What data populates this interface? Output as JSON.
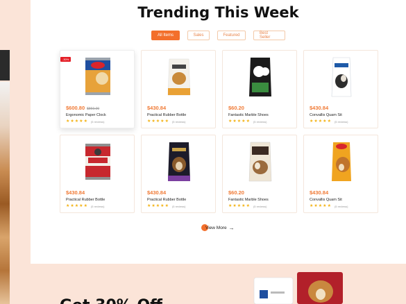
{
  "section": {
    "title": "Trending This Week"
  },
  "filters": [
    {
      "label": "All Items",
      "active": true
    },
    {
      "label": "Sales",
      "active": false
    },
    {
      "label": "Featured",
      "active": false
    },
    {
      "label": "Best Seller",
      "active": false
    }
  ],
  "products": [
    {
      "price": "$600.80",
      "old_price": "$860.00",
      "name": "Ergonomic Paper Clock",
      "stars": 5,
      "reviews": "(5 reviews)",
      "badge": "-30%",
      "image": "dog-food-can-icon"
    },
    {
      "price": "$430.84",
      "name": "Practical Rubber Bottle",
      "stars": 5,
      "reviews": "(5 reviews)",
      "image": "pet-food-bag-icon"
    },
    {
      "price": "$60.20",
      "name": "Fantastic Marble Shoes",
      "stars": 5,
      "reviews": "(5 reviews)",
      "image": "pet-food-bag-icon"
    },
    {
      "price": "$430.84",
      "name": "Convallis Quam Sit",
      "stars": 5,
      "reviews": "(5 reviews)",
      "image": "pet-food-bag-icon"
    },
    {
      "price": "$430.84",
      "name": "Practical Rubber Bottle",
      "stars": 5,
      "reviews": "(5 reviews)",
      "image": "dog-food-can-icon"
    },
    {
      "price": "$430.84",
      "name": "Practical Rubber Bottle",
      "stars": 5,
      "reviews": "(5 reviews)",
      "image": "pet-food-bag-icon"
    },
    {
      "price": "$60.20",
      "name": "Fantastic Marble Shoes",
      "stars": 5,
      "reviews": "(5 reviews)",
      "image": "pet-food-bag-icon"
    },
    {
      "price": "$430.84",
      "name": "Convallis Quam Sit",
      "stars": 5,
      "reviews": "(5 reviews)",
      "image": "pet-food-bag-icon"
    }
  ],
  "view_more": {
    "label": "View More",
    "icon": "arrow-right-icon"
  },
  "promo": {
    "text": "Get 30% Off"
  },
  "colors": {
    "accent": "#f36f2b",
    "price": "#f07a35",
    "star": "#f3b214",
    "badge": "#e41e26",
    "background": "#fdece3"
  }
}
